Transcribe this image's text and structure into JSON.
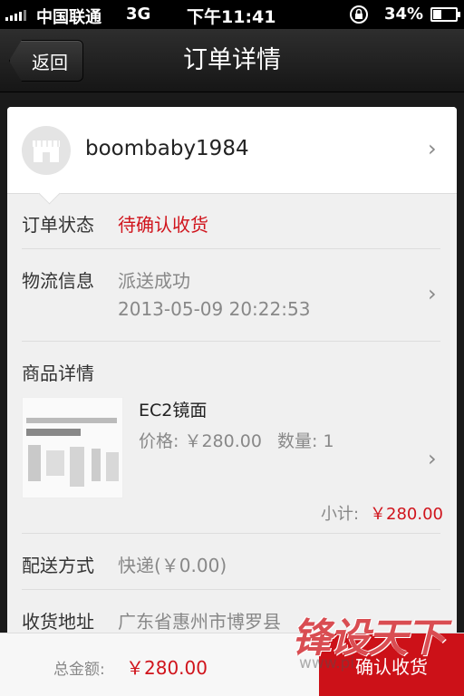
{
  "status_bar": {
    "carrier": "中国联通",
    "network": "3G",
    "time": "下午11:41",
    "battery": "34%"
  },
  "nav": {
    "back_label": "返回",
    "title": "订单详情"
  },
  "shop": {
    "name": "boombaby1984"
  },
  "order_status": {
    "label": "订单状态",
    "value": "待确认收货"
  },
  "logistics": {
    "label": "物流信息",
    "status": "派送成功",
    "time": "2013-05-09 20:22:53"
  },
  "product": {
    "section_label": "商品详情",
    "name": "EC2镜面",
    "price": "价格: ￥280.00",
    "quantity": "数量: 1",
    "subtotal_label": "小计:",
    "subtotal_value": "￥280.00"
  },
  "delivery": {
    "label": "配送方式",
    "value": "快递(￥0.00)"
  },
  "address": {
    "label": "收货地址",
    "value": "广东省惠州市博罗县"
  },
  "bottom": {
    "total_label": "总金额:",
    "total_value": "￥280.00",
    "confirm_label": "确认收货"
  },
  "watermark": {
    "text": "锋设天下",
    "url": "www.pi"
  },
  "colors": {
    "accent_red": "#cc1118",
    "nav_bg": "#1e1e1e"
  }
}
